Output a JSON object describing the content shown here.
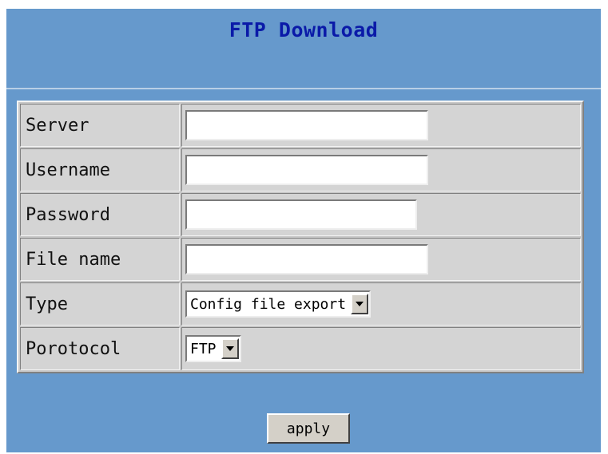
{
  "page": {
    "title": "FTP Download"
  },
  "form": {
    "rows": [
      {
        "label": "Server",
        "value": ""
      },
      {
        "label": "Username",
        "value": ""
      },
      {
        "label": "Password",
        "value": ""
      },
      {
        "label": "File name",
        "value": ""
      },
      {
        "label": "Type",
        "selected": "Config file export"
      },
      {
        "label": "Porotocol",
        "selected": "FTP"
      }
    ]
  },
  "actions": {
    "apply_label": "apply"
  },
  "colors": {
    "background": "#6699cc",
    "title_text": "#0a1aa8",
    "table_cell": "#d4d4d4"
  },
  "icons": {
    "dropdown": "chevron-down-icon"
  }
}
